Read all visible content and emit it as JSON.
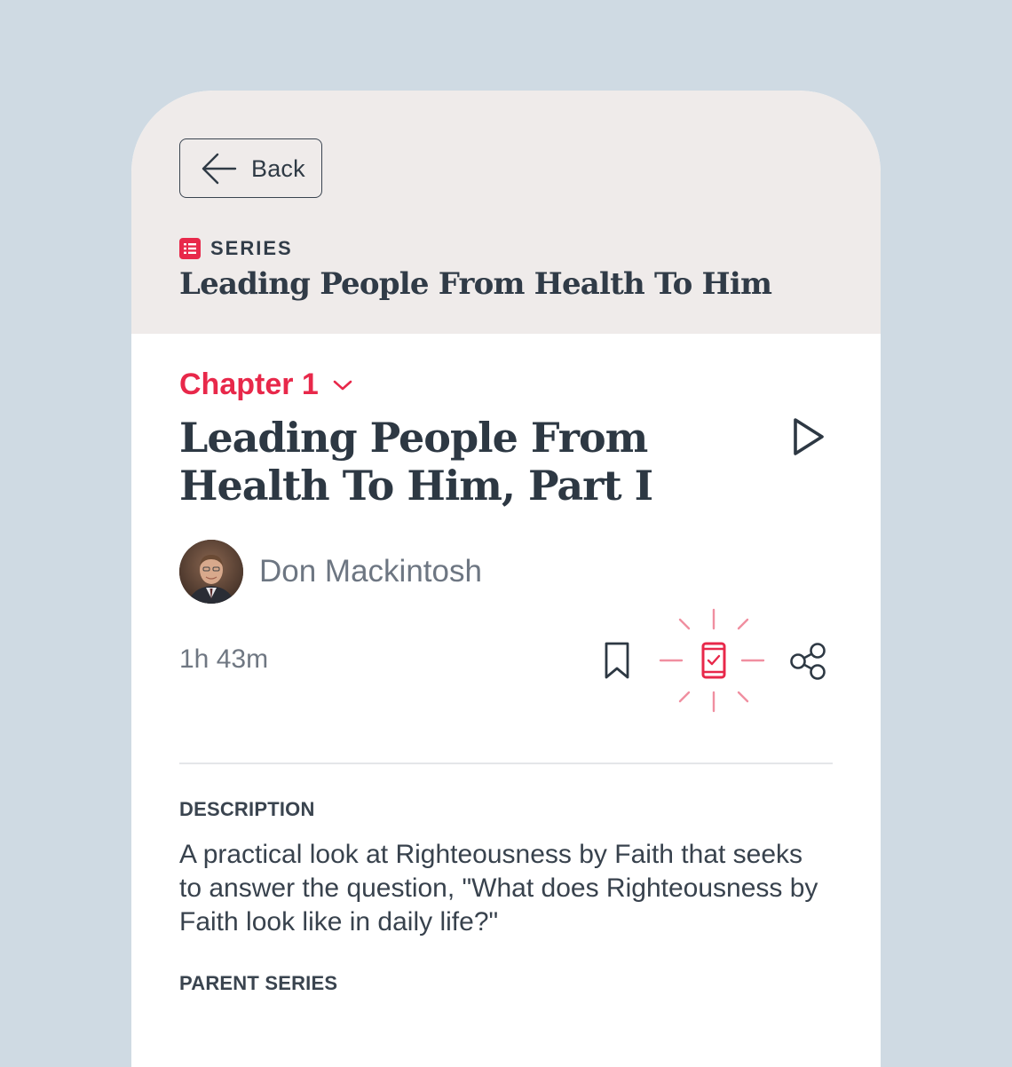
{
  "header": {
    "back_label": "Back",
    "series_label": "SERIES",
    "series_title": "Leading People From Health To Him"
  },
  "episode": {
    "chapter_label": "Chapter 1",
    "title": "Leading People From Health To Him, Part I",
    "author_name": "Don Mackintosh",
    "duration": "1h 43m"
  },
  "description": {
    "heading": "DESCRIPTION",
    "text": "A practical look at Righteousness by Faith that seeks to answer the question, \"What does Righteousness by Faith look like in daily life?\""
  },
  "parent_series": {
    "heading": "PARENT SERIES"
  },
  "icons": {
    "back": "arrow-left-icon",
    "series": "list-icon",
    "chapter_dropdown": "chevron-down-icon",
    "play": "play-icon",
    "bookmark": "bookmark-icon",
    "mobile_sync": "mobile-check-icon",
    "share": "share-icon"
  },
  "colors": {
    "background": "#cfdae3",
    "header_bg": "#efebea",
    "accent": "#e8284a",
    "text_dark": "#2d3843",
    "text_muted": "#6d7682"
  }
}
